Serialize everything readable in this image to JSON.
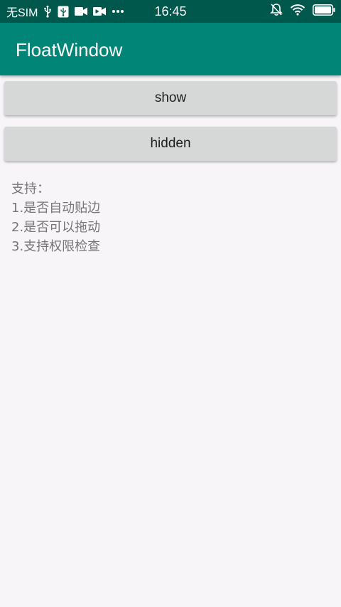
{
  "status_bar": {
    "carrier": "无SIM",
    "time": "16:45",
    "icons": [
      "usb-icon",
      "usb-debug-icon",
      "video-icon",
      "video-record-icon",
      "more-dots-icon",
      "notifications-off-icon",
      "wifi-icon",
      "battery-icon"
    ],
    "background_color": "#00574b"
  },
  "app_bar": {
    "title": "FloatWindow",
    "background_color": "#008577"
  },
  "buttons": {
    "show_label": "show",
    "hidden_label": "hidden"
  },
  "description": {
    "lines": [
      "支持：",
      "1.是否自动贴边",
      "2.是否可以拖动",
      "3.支持权限检查"
    ]
  }
}
